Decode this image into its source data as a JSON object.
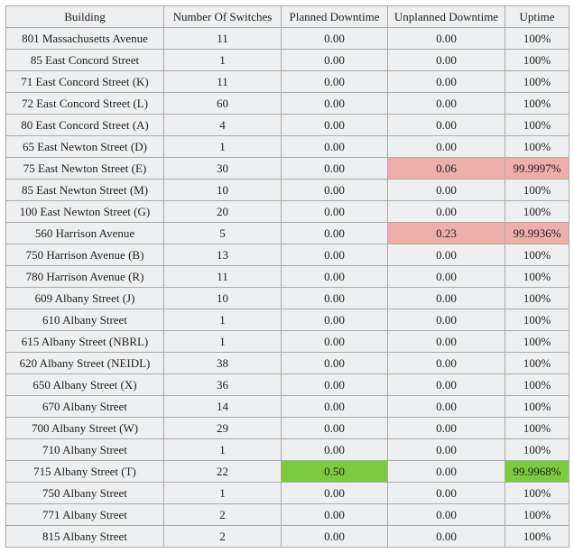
{
  "columns": [
    "Building",
    "Number Of Switches",
    "Planned Downtime",
    "Unplanned Downtime",
    "Uptime"
  ],
  "chart_data": {
    "type": "table",
    "title": "",
    "columns": [
      "Building",
      "Number Of Switches",
      "Planned Downtime",
      "Unplanned Downtime",
      "Uptime"
    ],
    "rows": [
      [
        "801 Massachusetts Avenue",
        "11",
        "0.00",
        "0.00",
        "100%"
      ],
      [
        "85 East Concord Street",
        "1",
        "0.00",
        "0.00",
        "100%"
      ],
      [
        "71 East Concord Street (K)",
        "11",
        "0.00",
        "0.00",
        "100%"
      ],
      [
        "72 East Concord Street (L)",
        "60",
        "0.00",
        "0.00",
        "100%"
      ],
      [
        "80 East Concord Street (A)",
        "4",
        "0.00",
        "0.00",
        "100%"
      ],
      [
        "65 East Newton Street (D)",
        "1",
        "0.00",
        "0.00",
        "100%"
      ],
      [
        "75 East Newton Street (E)",
        "30",
        "0.00",
        "0.06",
        "99.9997%"
      ],
      [
        "85 East Newton Street (M)",
        "10",
        "0.00",
        "0.00",
        "100%"
      ],
      [
        "100 East Newton Street (G)",
        "20",
        "0.00",
        "0.00",
        "100%"
      ],
      [
        "560 Harrison Avenue",
        "5",
        "0.00",
        "0.23",
        "99.9936%"
      ],
      [
        "750 Harrison Avenue (B)",
        "13",
        "0.00",
        "0.00",
        "100%"
      ],
      [
        "780 Harrison Avenue (R)",
        "11",
        "0.00",
        "0.00",
        "100%"
      ],
      [
        "609 Albany Street (J)",
        "10",
        "0.00",
        "0.00",
        "100%"
      ],
      [
        "610 Albany Street",
        "1",
        "0.00",
        "0.00",
        "100%"
      ],
      [
        "615 Albany Street (NBRL)",
        "1",
        "0.00",
        "0.00",
        "100%"
      ],
      [
        "620 Albany Street (NEIDL)",
        "38",
        "0.00",
        "0.00",
        "100%"
      ],
      [
        "650 Albany Street (X)",
        "36",
        "0.00",
        "0.00",
        "100%"
      ],
      [
        "670 Albany Street",
        "14",
        "0.00",
        "0.00",
        "100%"
      ],
      [
        "700 Albany Street (W)",
        "29",
        "0.00",
        "0.00",
        "100%"
      ],
      [
        "710 Albany Street",
        "1",
        "0.00",
        "0.00",
        "100%"
      ],
      [
        "715 Albany Street (T)",
        "22",
        "0.50",
        "0.00",
        "99.9968%"
      ],
      [
        "750 Albany Street",
        "1",
        "0.00",
        "0.00",
        "100%"
      ],
      [
        "771 Albany Street",
        "2",
        "0.00",
        "0.00",
        "100%"
      ],
      [
        "815 Albany Street",
        "2",
        "0.00",
        "0.00",
        "100%"
      ]
    ]
  },
  "highlights": [
    {
      "row": 6,
      "col": 3,
      "class": "hl-red"
    },
    {
      "row": 6,
      "col": 4,
      "class": "hl-red"
    },
    {
      "row": 9,
      "col": 3,
      "class": "hl-red"
    },
    {
      "row": 9,
      "col": 4,
      "class": "hl-red"
    },
    {
      "row": 20,
      "col": 2,
      "class": "hl-green"
    },
    {
      "row": 20,
      "col": 4,
      "class": "hl-green"
    }
  ]
}
